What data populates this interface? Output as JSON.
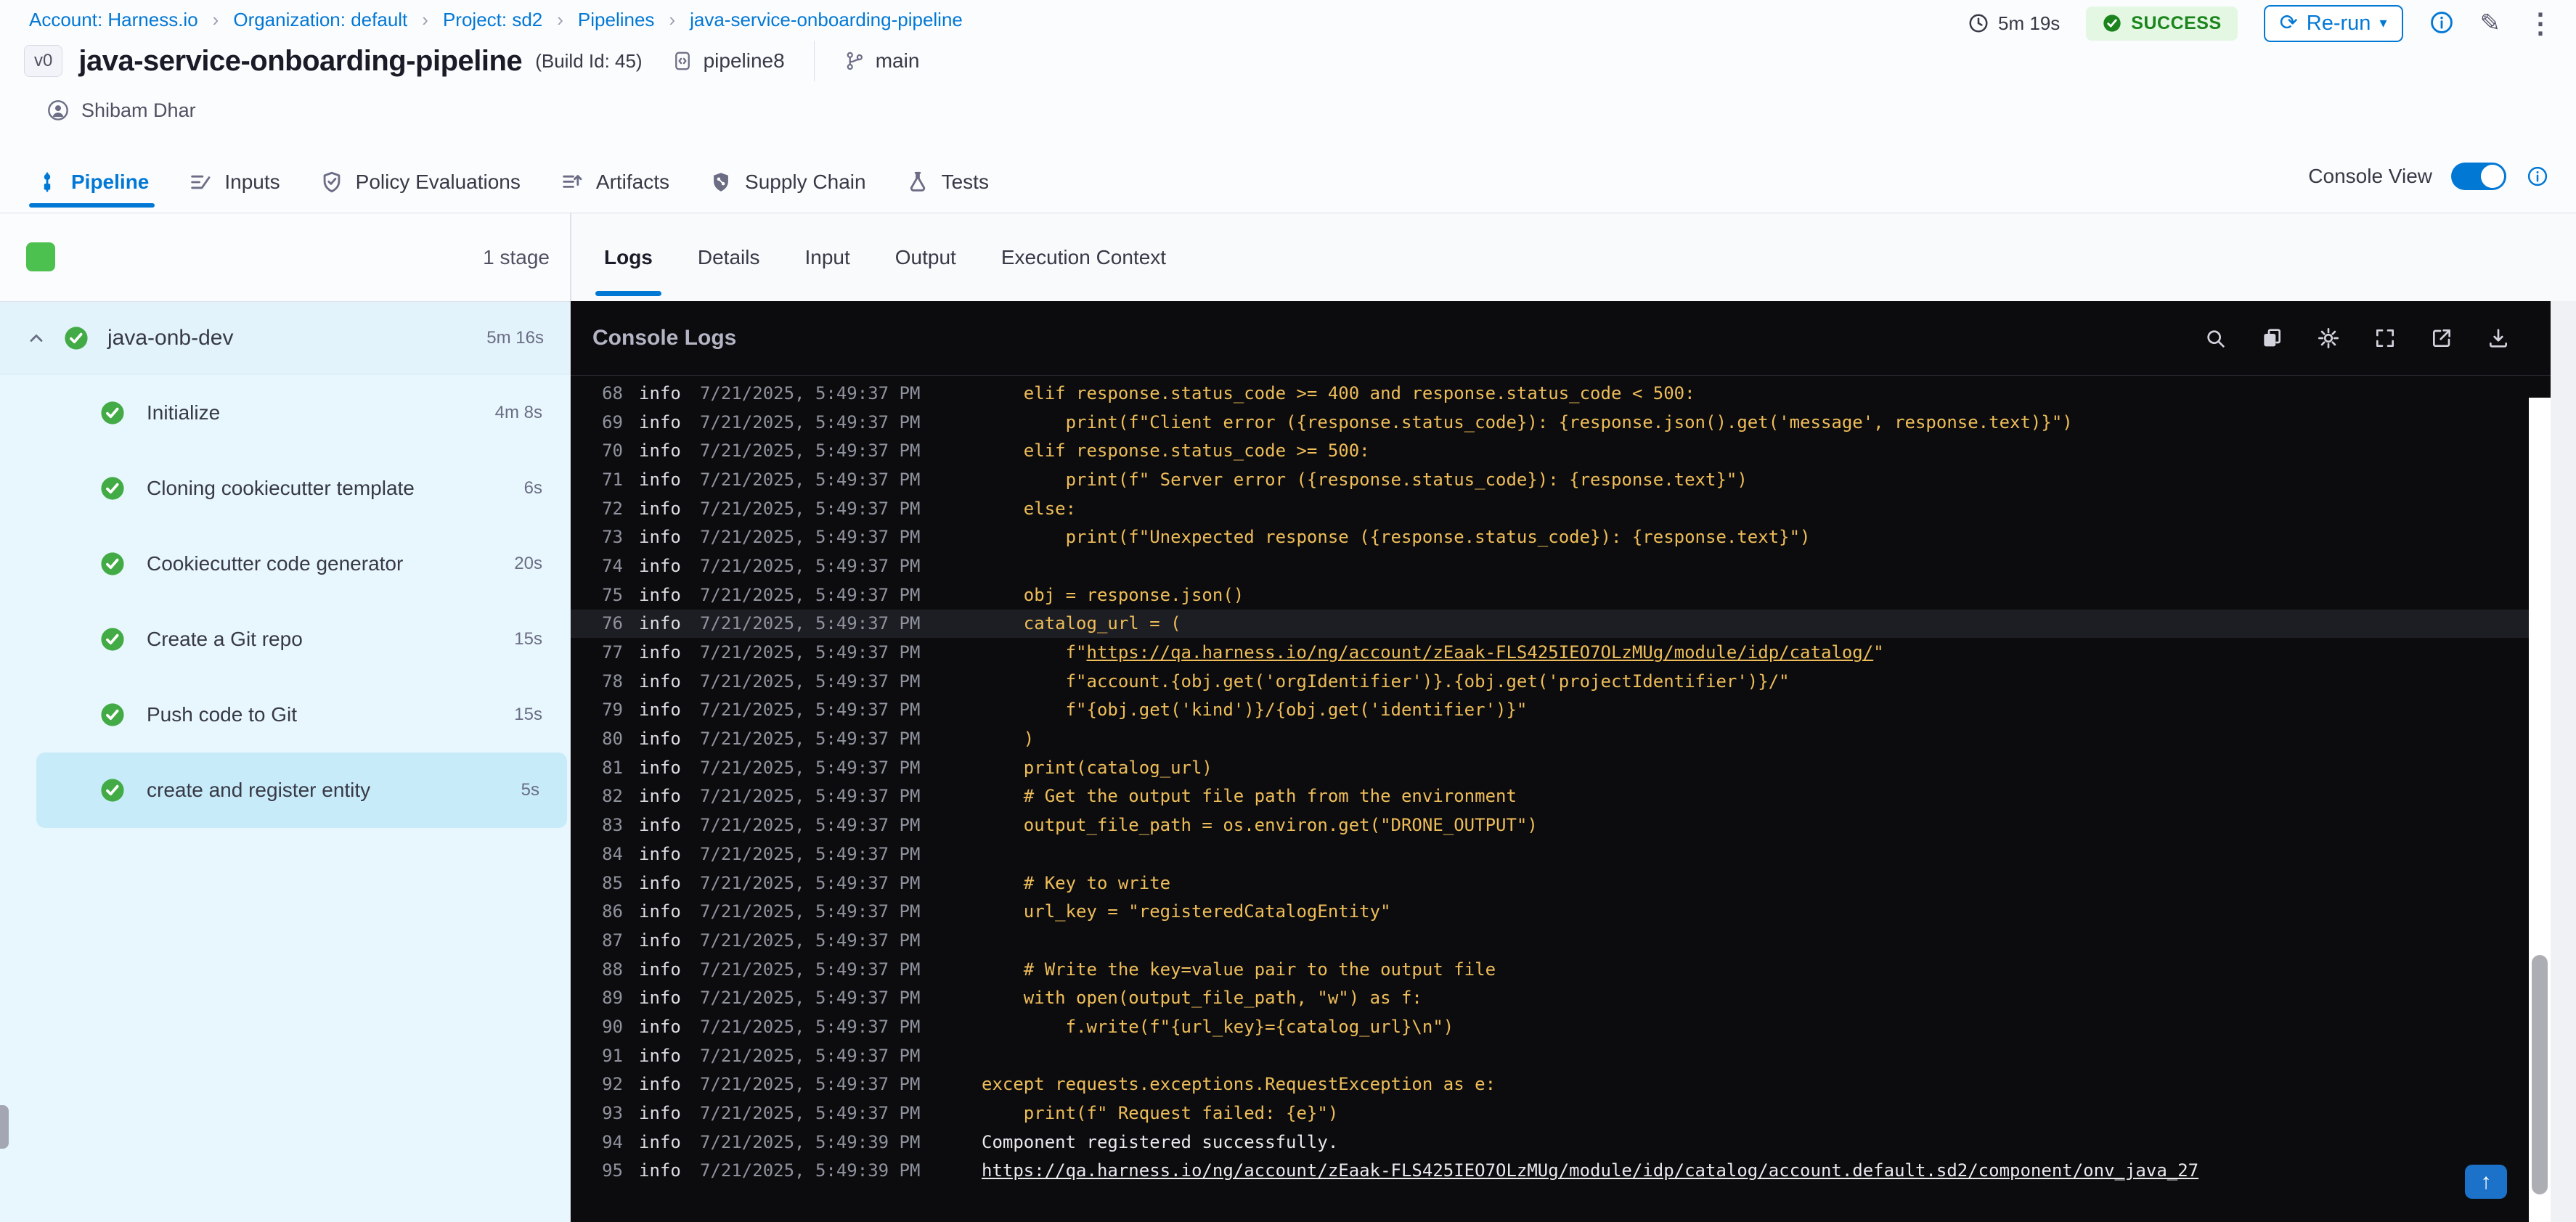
{
  "breadcrumb": {
    "items": [
      "Account: Harness.io",
      "Organization: default",
      "Project: sd2",
      "Pipelines",
      "java-service-onboarding-pipeline"
    ]
  },
  "header": {
    "version_badge": "v0",
    "title": "java-service-onboarding-pipeline",
    "build_id": "(Build Id: 45)",
    "pipeline_tag": "pipeline8",
    "branch": "main",
    "user": "Shibam Dhar",
    "duration": "5m 19s",
    "status": "SUCCESS",
    "rerun_label": "Re-run"
  },
  "glyphs": {
    "refresh": "⟳",
    "caret_down": "▾",
    "edit": "✎",
    "kebab": "⋮",
    "up_arrow": "↑",
    "crumb_sep": "›"
  },
  "nav_tabs": {
    "items": [
      {
        "label": "Pipeline",
        "icon": "pipeline-icon",
        "active": true
      },
      {
        "label": "Inputs",
        "icon": "inputs-icon",
        "active": false
      },
      {
        "label": "Policy Evaluations",
        "icon": "policy-icon",
        "active": false
      },
      {
        "label": "Artifacts",
        "icon": "artifacts-icon",
        "active": false
      },
      {
        "label": "Supply Chain",
        "icon": "supply-chain-icon",
        "active": false
      },
      {
        "label": "Tests",
        "icon": "tests-icon",
        "active": false
      }
    ],
    "console_view_label": "Console View",
    "console_view_on": true
  },
  "sidebar": {
    "stage_count_label": "1 stage",
    "stage": {
      "name": "java-onb-dev",
      "duration": "5m 16s",
      "status": "success"
    },
    "steps": [
      {
        "name": "Initialize",
        "duration": "4m 8s",
        "selected": false
      },
      {
        "name": "Cloning cookiecutter template",
        "duration": "6s",
        "selected": false
      },
      {
        "name": "Cookiecutter code generator",
        "duration": "20s",
        "selected": false
      },
      {
        "name": "Create a Git repo",
        "duration": "15s",
        "selected": false
      },
      {
        "name": "Push code to Git",
        "duration": "15s",
        "selected": false
      },
      {
        "name": "create and register entity",
        "duration": "5s",
        "selected": true
      }
    ]
  },
  "log_panel": {
    "tabs": [
      {
        "label": "Logs",
        "active": true
      },
      {
        "label": "Details",
        "active": false
      },
      {
        "label": "Input",
        "active": false
      },
      {
        "label": "Output",
        "active": false
      },
      {
        "label": "Execution Context",
        "active": false
      }
    ],
    "console_title": "Console Logs",
    "toolbar_icons": [
      "search-icon",
      "copy-icon",
      "settings-icon",
      "fullscreen-icon",
      "open-in-new-icon",
      "download-icon"
    ]
  },
  "console": {
    "level_label": "info",
    "rows": [
      {
        "n": "68",
        "time": "7/21/2025, 5:49:37 PM",
        "t": "    elif response.status_code >= 400 and response.status_code < 500:"
      },
      {
        "n": "69",
        "time": "7/21/2025, 5:49:37 PM",
        "t": "        print(f\"Client error ({response.status_code}): {response.json().get('message', response.text)}\")"
      },
      {
        "n": "70",
        "time": "7/21/2025, 5:49:37 PM",
        "t": "    elif response.status_code >= 500:"
      },
      {
        "n": "71",
        "time": "7/21/2025, 5:49:37 PM",
        "t": "        print(f\" Server error ({response.status_code}): {response.text}\")"
      },
      {
        "n": "72",
        "time": "7/21/2025, 5:49:37 PM",
        "t": "    else:"
      },
      {
        "n": "73",
        "time": "7/21/2025, 5:49:37 PM",
        "t": "        print(f\"Unexpected response ({response.status_code}): {response.text}\")"
      },
      {
        "n": "74",
        "time": "7/21/2025, 5:49:37 PM",
        "t": ""
      },
      {
        "n": "75",
        "time": "7/21/2025, 5:49:37 PM",
        "t": "    obj = response.json()"
      },
      {
        "n": "76",
        "time": "7/21/2025, 5:49:37 PM",
        "t": "    catalog_url = (",
        "hl": true
      },
      {
        "n": "77",
        "time": "7/21/2025, 5:49:37 PM",
        "segs": [
          {
            "t": "        f\""
          },
          {
            "t": "https://qa.harness.io/ng/account/zEaak-FLS425IEO7OLzMUg/module/idp/catalog/",
            "u": true
          },
          {
            "t": "\""
          }
        ]
      },
      {
        "n": "78",
        "time": "7/21/2025, 5:49:37 PM",
        "t": "        f\"account.{obj.get('orgIdentifier')}.{obj.get('projectIdentifier')}/\""
      },
      {
        "n": "79",
        "time": "7/21/2025, 5:49:37 PM",
        "t": "        f\"{obj.get('kind')}/{obj.get('identifier')}\""
      },
      {
        "n": "80",
        "time": "7/21/2025, 5:49:37 PM",
        "t": "    )"
      },
      {
        "n": "81",
        "time": "7/21/2025, 5:49:37 PM",
        "t": "    print(catalog_url)"
      },
      {
        "n": "82",
        "time": "7/21/2025, 5:49:37 PM",
        "t": "    # Get the output file path from the environment"
      },
      {
        "n": "83",
        "time": "7/21/2025, 5:49:37 PM",
        "t": "    output_file_path = os.environ.get(\"DRONE_OUTPUT\")"
      },
      {
        "n": "84",
        "time": "7/21/2025, 5:49:37 PM",
        "t": ""
      },
      {
        "n": "85",
        "time": "7/21/2025, 5:49:37 PM",
        "t": "    # Key to write"
      },
      {
        "n": "86",
        "time": "7/21/2025, 5:49:37 PM",
        "t": "    url_key = \"registeredCatalogEntity\""
      },
      {
        "n": "87",
        "time": "7/21/2025, 5:49:37 PM",
        "t": ""
      },
      {
        "n": "88",
        "time": "7/21/2025, 5:49:37 PM",
        "t": "    # Write the key=value pair to the output file"
      },
      {
        "n": "89",
        "time": "7/21/2025, 5:49:37 PM",
        "t": "    with open(output_file_path, \"w\") as f:"
      },
      {
        "n": "90",
        "time": "7/21/2025, 5:49:37 PM",
        "t": "        f.write(f\"{url_key}={catalog_url}\\n\")"
      },
      {
        "n": "91",
        "time": "7/21/2025, 5:49:37 PM",
        "t": ""
      },
      {
        "n": "92",
        "time": "7/21/2025, 5:49:37 PM",
        "t": "except requests.exceptions.RequestException as e:"
      },
      {
        "n": "93",
        "time": "7/21/2025, 5:49:37 PM",
        "t": "    print(f\" Request failed: {e}\")"
      },
      {
        "n": "94",
        "time": "7/21/2025, 5:49:39 PM",
        "t": "Component registered successfully.",
        "plain": true
      },
      {
        "n": "95",
        "time": "7/21/2025, 5:49:39 PM",
        "segs": [
          {
            "t": "https://qa.harness.io/ng/account/zEaak-FLS425IEO7OLzMUg/module/idp/catalog/account.default.sd2/component/onv_java_27",
            "u": true
          }
        ],
        "plain": true
      }
    ]
  },
  "colors": {
    "accent": "#0278d5",
    "success_green": "#42ab45",
    "status_badge_bg": "#e3f7e3",
    "status_badge_text": "#1b841d",
    "console_bg": "#0c0c0e",
    "log_code": "#eebd59",
    "sidebar_bg": "#e8f7fd",
    "selected_step_bg": "#c7ebf9"
  }
}
